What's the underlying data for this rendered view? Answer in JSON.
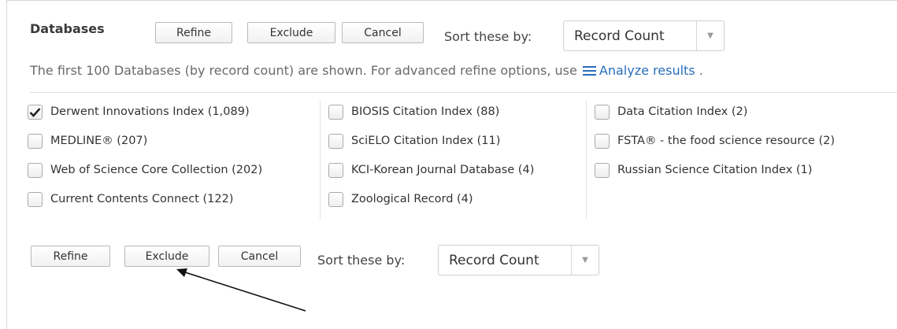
{
  "top_bar": {
    "title": "Databases",
    "refine_label": "Refine",
    "exclude_label": "Exclude",
    "cancel_label": "Cancel",
    "sort_label": "Sort these by:",
    "sort_value": "Record Count"
  },
  "info": {
    "text": "The first 100 Databases (by record count) are shown. For advanced refine options, use",
    "link_label": "Analyze results",
    "trailing": "."
  },
  "options": {
    "col1": [
      {
        "label": "Derwent Innovations Index (1,089)",
        "checked": true
      },
      {
        "label": "MEDLINE® (207)",
        "checked": false
      },
      {
        "label": "Web of Science Core Collection (202)",
        "checked": false
      },
      {
        "label": "Current Contents Connect (122)",
        "checked": false
      }
    ],
    "col2": [
      {
        "label": "BIOSIS Citation Index (88)",
        "checked": false
      },
      {
        "label": "SciELO Citation Index (11)",
        "checked": false
      },
      {
        "label": "KCI-Korean Journal Database (4)",
        "checked": false
      },
      {
        "label": "Zoological Record (4)",
        "checked": false
      }
    ],
    "col3": [
      {
        "label": "Data Citation Index (2)",
        "checked": false
      },
      {
        "label": "FSTA® - the food science resource (2)",
        "checked": false
      },
      {
        "label": "Russian Science Citation Index (1)",
        "checked": false
      }
    ]
  },
  "bottom_bar": {
    "refine_label": "Refine",
    "exclude_label": "Exclude",
    "cancel_label": "Cancel",
    "sort_label": "Sort these by:",
    "sort_value": "Record Count"
  },
  "colors": {
    "link": "#2a6ebb",
    "arrow": "#111111"
  },
  "icons": {
    "analyze": "menu-lines-icon",
    "dropdown": "chevron-down-icon",
    "checked": "checkmark-icon"
  }
}
